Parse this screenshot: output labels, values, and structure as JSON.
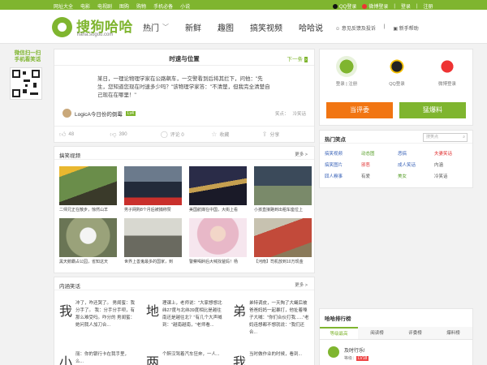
{
  "topbar": {
    "links": [
      "网址大全",
      "电影",
      "电视剧",
      "图购",
      "购物",
      "手机必备",
      "小说"
    ],
    "qq_login": "QQ登录",
    "weibo_login": "微博登录",
    "login": "登录",
    "register": "注册"
  },
  "header": {
    "logo_name": "搜狗哈哈",
    "logo_domain": "haha.sogou.com",
    "nav": [
      {
        "label": "热门",
        "dropdown": true
      },
      {
        "label": "新鲜",
        "dropdown": false
      },
      {
        "label": "趣图",
        "dropdown": false
      },
      {
        "label": "搞笑视频",
        "dropdown": false
      },
      {
        "label": "哈哈说",
        "dropdown": false
      }
    ],
    "feedback": "意见反馈及投诉",
    "help": "新手帮助"
  },
  "qr": {
    "line1": "微信扫一扫",
    "line2": "手机看笑话"
  },
  "article": {
    "title": "时速与位置",
    "next": "下一条",
    "body": "某日，一理论物理学家在公路飙车，一交警看到后将其拦下，问他：\"先生，您知道您现在时速多少吗？\"该物理学家答：\"不清楚，但我完全清楚自己现在在哪里！\"",
    "author": "LogicA今日份的倒霉",
    "author_level": "Lv4",
    "tags": [
      "笑点：",
      "冷笑话"
    ],
    "likes": "48",
    "dislikes": "390",
    "comments_label": "评论 0",
    "favorite": "收藏",
    "share": "分享"
  },
  "videos": {
    "title": "搞笑视频",
    "more": "更多 >",
    "items": [
      {
        "caption": "二师兄正在散步，惊然山羊"
      },
      {
        "caption": "男子网购8个月后被捕称赞"
      },
      {
        "caption": "美国航媒在中国，大街上看"
      },
      {
        "caption": "小孩直接路到出租车座位上"
      },
      {
        "caption": "黑天鹅霸占公园，省知这天"
      },
      {
        "caption": "世界上善鬼最多的国家，到"
      },
      {
        "caption": "警察喝醉后大喊找爸妈！杨"
      },
      {
        "caption": "【河南】司机放到10万现金"
      }
    ]
  },
  "jokes": {
    "title": "内涵笑话",
    "more": "更多 >",
    "items": [
      {
        "char": "我",
        "text": "冲了，咋还哭了。 男闺蜜：我分手了。 我：分手分手呗，有那么难受吗。咋分的 男闺蜜：她问我人加刀合..."
      },
      {
        "char": "地",
        "text": "理课上，老师说：\"大家想想北纬27度与北纬39度相比是越往南还是越往北？\"有几个大声喊到：\"越南越南，\"老师看..."
      },
      {
        "char": "弟",
        "text": "弟特调皮，一天掏了大蝇后被爸爸妈妈一起暴打，他扯着嗓子大喊：\"你们合伙打我......\"老妈连想都不想就说：\"我们还合..."
      },
      {
        "char": "小",
        "text": "丽：你的银行卡在我手里，么..."
      },
      {
        "char": "两",
        "text": "个醉汉驾着汽车狂奔，一人..."
      },
      {
        "char": "我",
        "text": "当时做作业的时候，看到..."
      }
    ]
  },
  "login_card": {
    "wx_label": "登录 | 注册",
    "qq_label": "QQ登录",
    "weibo_label": "微博登录",
    "review_btn": "当评委",
    "report_btn": "猛爆料"
  },
  "hot": {
    "title": "热门笑点",
    "search_placeholder": "搜笑点",
    "items": [
      "搞笑视频",
      "动态图",
      "恶搞",
      "夫妻笑话",
      "搞笑图片",
      "邪恶",
      "成人笑话",
      "内涵",
      "囧人糗事",
      "有爱",
      "美女",
      "冷笑话"
    ],
    "item_colors": [
      "#3a63b8",
      "#5aa02c",
      "#3a63b8",
      "#e03030",
      "#3a63b8",
      "#e03030",
      "#3a63b8",
      "#555",
      "#3a63b8",
      "#555",
      "#5aa02c",
      "#555"
    ]
  },
  "rank": {
    "title": "哈哈排行榜",
    "tabs": [
      "等级最高",
      "阅读榜",
      "评委榜",
      "爆料榜"
    ],
    "top_user": "及时行乐!",
    "top_level": "等级：",
    "top_badge": "LV18"
  },
  "colors": {
    "brand": "#7fb52f",
    "orange": "#f17512"
  }
}
